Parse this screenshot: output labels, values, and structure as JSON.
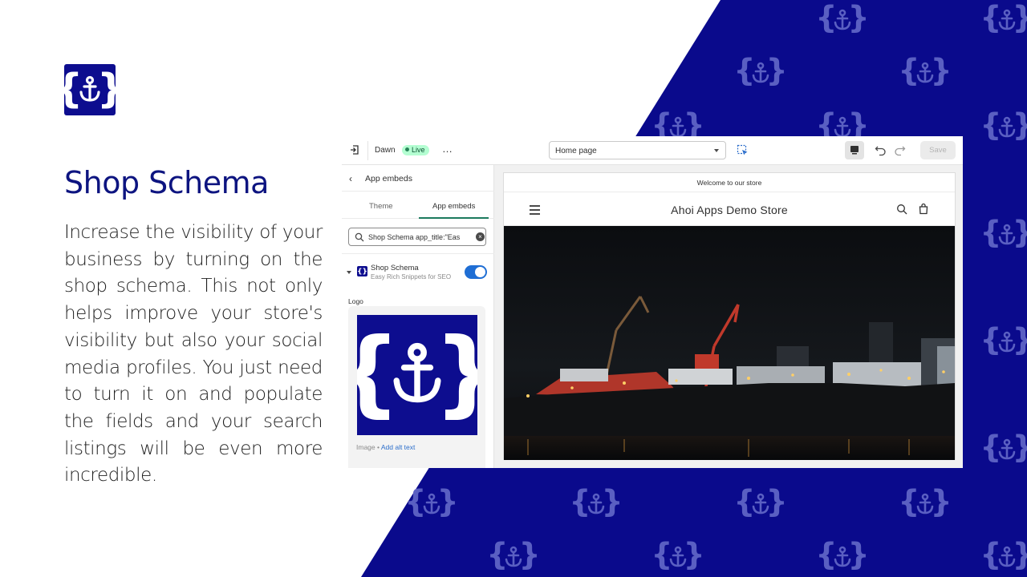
{
  "slide": {
    "title": "Shop Schema",
    "description": "Increase the visibility of your business by turning on the shop schema. This not only helps improve your store's visibility but also your social media profiles. You just need to turn it on and populate the fields and your search listings will be even more incredible.",
    "colors": {
      "brand_blue": "#0d0d8f",
      "title_blue": "#0d1480",
      "text": "#1f1f1f"
    }
  },
  "topbar": {
    "theme_name": "Dawn",
    "status_badge": "Live",
    "more_icon": "…",
    "page_select": "Home page",
    "save_label": "Save"
  },
  "sidebar": {
    "title": "App embeds",
    "tabs": [
      {
        "label": "Theme"
      },
      {
        "label": "App embeds"
      }
    ],
    "search_value": "Shop Schema app_title:\"Eas",
    "embed": {
      "name": "Shop Schema",
      "description": "Easy Rich Snippets for SEO",
      "enabled": true
    },
    "logo_label": "Logo",
    "image_meta": "Image",
    "image_meta_sep": " • ",
    "alt_text_link": "Add alt text"
  },
  "preview": {
    "announcement": "Welcome to our store",
    "store_name": "Ahoi Apps Demo Store"
  },
  "icons": [
    "anchor-brace-logo-icon",
    "exit-icon",
    "more-icon",
    "inspect-icon",
    "desktop-icon",
    "undo-icon",
    "redo-icon",
    "back-chevron-icon",
    "search-icon",
    "clear-icon",
    "menu-icon",
    "cart-icon"
  ]
}
